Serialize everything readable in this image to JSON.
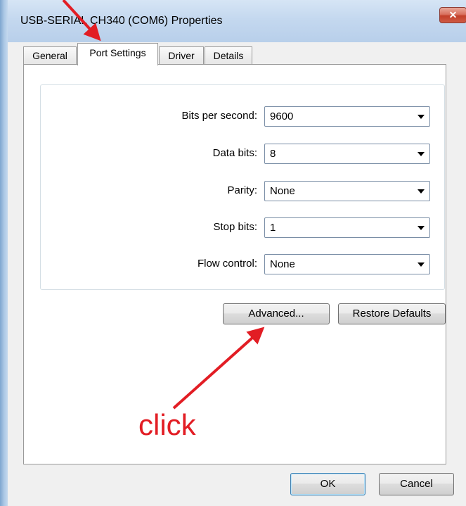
{
  "window": {
    "title": "USB-SERIAL CH340 (COM6) Properties",
    "close_glyph": "✕"
  },
  "tabs": [
    {
      "label": "General",
      "active": false
    },
    {
      "label": "Port Settings",
      "active": true
    },
    {
      "label": "Driver",
      "active": false
    },
    {
      "label": "Details",
      "active": false
    }
  ],
  "settings": [
    {
      "label": "Bits per second:",
      "value": "9600"
    },
    {
      "label": "Data bits:",
      "value": "8"
    },
    {
      "label": "Parity:",
      "value": "None"
    },
    {
      "label": "Stop bits:",
      "value": "1"
    },
    {
      "label": "Flow control:",
      "value": "None"
    }
  ],
  "buttons": {
    "advanced": "Advanced...",
    "restore_defaults": "Restore Defaults",
    "ok": "OK",
    "cancel": "Cancel"
  },
  "annotation": {
    "text": "click",
    "color": "#e21d24"
  },
  "colors": {
    "titlebar": "#c4d8ef",
    "close_button": "#c23f2a",
    "dialog_background": "#f0f0f0"
  }
}
